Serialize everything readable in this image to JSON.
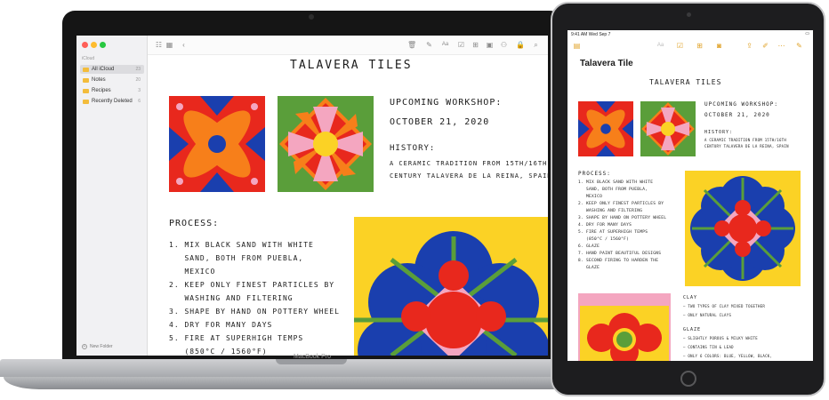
{
  "mac": {
    "brand": "MacBook Pro",
    "sidebar": {
      "section": "iCloud",
      "items": [
        {
          "label": "All iCloud",
          "count": "23"
        },
        {
          "label": "Notes",
          "count": "20"
        },
        {
          "label": "Recipes",
          "count": "3"
        },
        {
          "label": "Recently Deleted",
          "count": "6"
        }
      ],
      "new_folder": "New Folder"
    },
    "note": {
      "title": "TALAVERA TILES",
      "workshop_heading": "UPCOMING WORKSHOP:",
      "workshop_date": "OCTOBER 21, 2020",
      "history_heading": "HISTORY:",
      "history_line1": "A CERAMIC TRADITION FROM 15TH/16TH",
      "history_line2": "CENTURY TALAVERA DE LA REINA, SPAIN",
      "process_heading": "PROCESS:",
      "steps": [
        "1. MIX BLACK SAND WITH WHITE",
        "   SAND, BOTH FROM PUEBLA,",
        "   MEXICO",
        "2. KEEP ONLY FINEST PARTICLES BY",
        "   WASHING AND FILTERING",
        "3. SHAPE BY HAND ON POTTERY WHEEL",
        "4. DRY FOR MANY DAYS",
        "5. FIRE AT SUPERHIGH TEMPS",
        "   (850°C / 1560°F)"
      ]
    }
  },
  "ipad": {
    "status_time": "9:41 AM  Wed Sep 7",
    "title": "Talavera Tile",
    "note": {
      "title": "TALAVERA TILES",
      "workshop_heading": "UPCOMING WORKSHOP:",
      "workshop_date": "OCTOBER 21, 2020",
      "history_heading": "HISTORY:",
      "history_line1": "A CERAMIC TRADITION FROM 15TH/16TH",
      "history_line2": "CENTURY TALAVERA DE LA REINA, SPAIN",
      "process_heading": "PROCESS:",
      "steps": [
        "1. MIX BLACK SAND WITH WHITE",
        "   SAND, BOTH FROM PUEBLA,",
        "   MEXICO",
        "2. KEEP ONLY FINEST PARTICLES BY",
        "   WASHING AND FILTERING",
        "3. SHAPE BY HAND ON POTTERY WHEEL",
        "4. DRY FOR MANY DAYS",
        "5. FIRE AT SUPERHIGH TEMPS",
        "   (850°C / 1560°F)",
        "6. GLAZE",
        "7. HAND PAINT BEAUTIFUL DESIGNS",
        "8. SECOND FIRING TO HARDEN THE",
        "   GLAZE"
      ],
      "clay_heading": "CLAY",
      "clay_items": [
        "— TWO TYPES OF CLAY MIXED TOGETHER",
        "— ONLY NATURAL CLAYS"
      ],
      "glaze_heading": "GLAZE",
      "glaze_items": [
        "— SLIGHTLY POROUS & MILKY WHITE",
        "— CONTAINS TIN & LEAD",
        "— ONLY 6 COLORS: BLUE, YELLOW, BLACK,"
      ]
    }
  },
  "colors": {
    "red": "#e8281d",
    "orange": "#f77f1a",
    "blue": "#1a3fae",
    "pink": "#f4a6c0",
    "yellow": "#fbd225",
    "green": "#5a9e3a",
    "accent": "#e0a32a"
  }
}
